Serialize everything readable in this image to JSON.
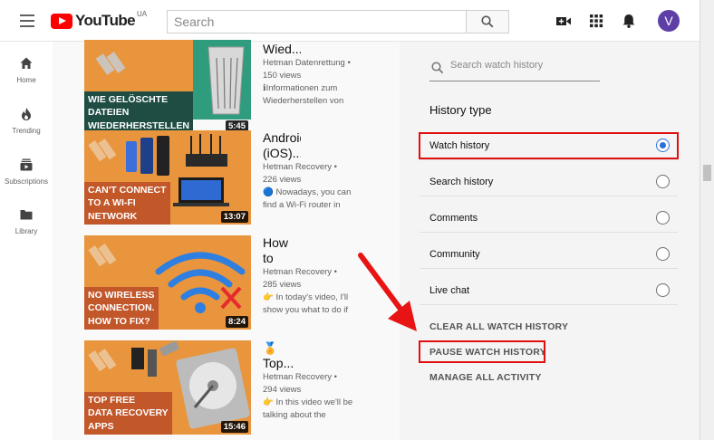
{
  "header": {
    "logo_text": "YouTube",
    "country_code": "UA",
    "search_placeholder": "Search",
    "avatar_letter": "V"
  },
  "nav": [
    {
      "label": "Home",
      "icon": "home-icon"
    },
    {
      "label": "Trending",
      "icon": "flame-icon"
    },
    {
      "label": "Subscriptions",
      "icon": "subscriptions-icon"
    },
    {
      "label": "Library",
      "icon": "folder-icon"
    }
  ],
  "videos": [
    {
      "title": "Wied...",
      "channel": "Hetman Datenrettung •",
      "views": "150 views",
      "desc1": "ℹInformationen zum",
      "desc2": "Wiederherstellen von",
      "thumb_text": [
        "WIE GELÖSCHTE",
        "DATEIEN",
        "WIEDERHERSTELLEN"
      ],
      "duration": "5:45"
    },
    {
      "title": "Android (iOS)...",
      "channel": "Hetman Recovery •",
      "views": "226 views",
      "desc1": "🔵 Nowadays, you can",
      "desc2": "find a Wi-Fi router in",
      "thumb_text": [
        "CAN'T CONNECT",
        "TO A WI-FI",
        "NETWORK"
      ],
      "duration": "13:07"
    },
    {
      "title": "How to Fix...",
      "channel": "Hetman Recovery •",
      "views": "285 views",
      "desc1": "👉 In today's video, I'll",
      "desc2": "show you what to do if",
      "thumb_text": [
        "NO WIRELESS",
        "CONNECTION.",
        "HOW TO FIX?"
      ],
      "duration": "8:24"
    },
    {
      "title": "Top...",
      "badge": "🏅",
      "channel": "Hetman Recovery •",
      "views": "294 views",
      "desc1": "👉 In this video we'll be",
      "desc2": "talking about the",
      "thumb_text": [
        "TOP FREE",
        "DATA RECOVERY",
        "APPS"
      ],
      "duration": "15:46"
    }
  ],
  "history_panel": {
    "search_placeholder": "Search watch history",
    "section_title": "History type",
    "options": [
      {
        "label": "Watch history",
        "selected": true
      },
      {
        "label": "Search history",
        "selected": false
      },
      {
        "label": "Comments",
        "selected": false
      },
      {
        "label": "Community",
        "selected": false
      },
      {
        "label": "Live chat",
        "selected": false
      }
    ],
    "actions": [
      "CLEAR ALL WATCH HISTORY",
      "PAUSE WATCH HISTORY",
      "MANAGE ALL ACTIVITY"
    ]
  },
  "colors": {
    "highlight": "#e01010",
    "arrow": "#e81414",
    "radio_selected": "#2a6fdb",
    "thumb_orange": "#e8953e",
    "thumb_green": "#2f9d7d",
    "avatar": "#5d3fa6"
  }
}
